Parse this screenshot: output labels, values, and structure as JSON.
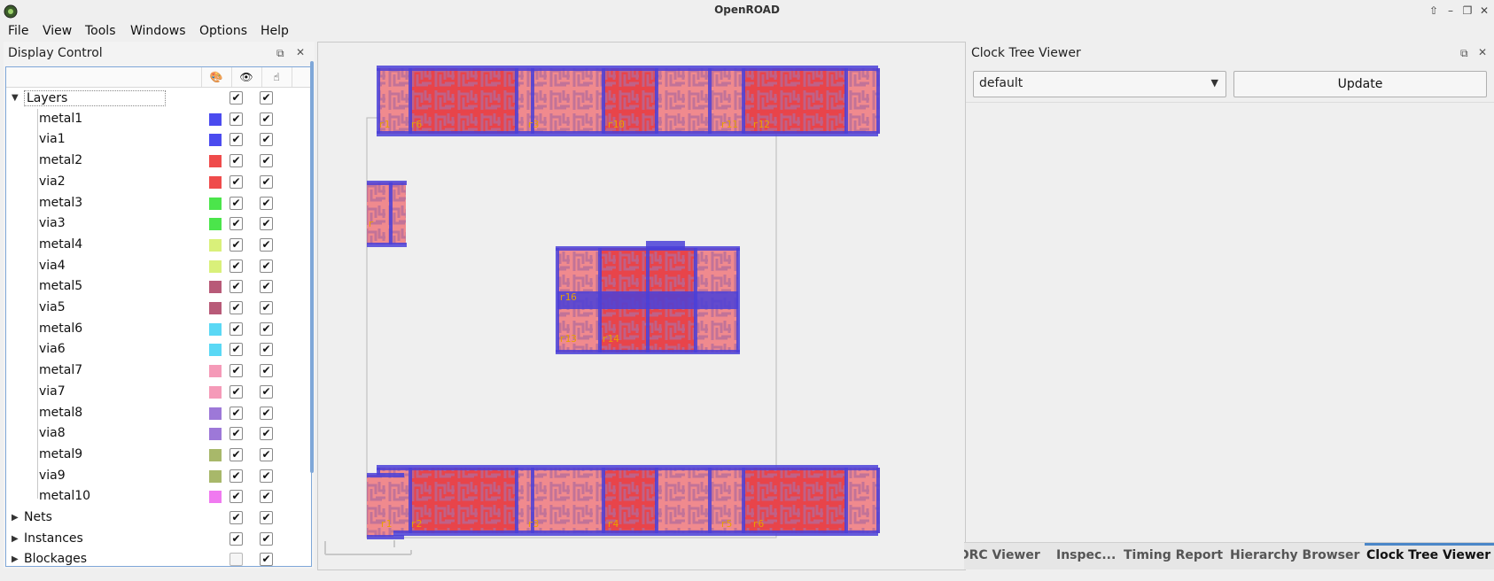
{
  "app": {
    "title": "OpenROAD"
  },
  "menu": [
    "File",
    "View",
    "Tools",
    "Windows",
    "Options",
    "Help"
  ],
  "display_control": {
    "title": "Display Control",
    "layers_label": "Layers",
    "layers": [
      {
        "name": "metal1",
        "color": "#4b4bef"
      },
      {
        "name": "via1",
        "color": "#4b4bef"
      },
      {
        "name": "metal2",
        "color": "#ef4b4b"
      },
      {
        "name": "via2",
        "color": "#ef4b4b"
      },
      {
        "name": "metal3",
        "color": "#4be54b"
      },
      {
        "name": "via3",
        "color": "#4be54b"
      },
      {
        "name": "metal4",
        "color": "#d9f07a"
      },
      {
        "name": "via4",
        "color": "#d9f07a"
      },
      {
        "name": "metal5",
        "color": "#b85a78"
      },
      {
        "name": "via5",
        "color": "#b85a78"
      },
      {
        "name": "metal6",
        "color": "#5ad8f5"
      },
      {
        "name": "via6",
        "color": "#5ad8f5"
      },
      {
        "name": "metal7",
        "color": "#f59ab8"
      },
      {
        "name": "via7",
        "color": "#f59ab8"
      },
      {
        "name": "metal8",
        "color": "#9d78d8"
      },
      {
        "name": "via8",
        "color": "#9d78d8"
      },
      {
        "name": "metal9",
        "color": "#a8b86a"
      },
      {
        "name": "via9",
        "color": "#a8b86a"
      },
      {
        "name": "metal10",
        "color": "#f07af0"
      }
    ],
    "groups": [
      {
        "name": "Nets",
        "visible": true,
        "selectable": true
      },
      {
        "name": "Instances",
        "visible": true,
        "selectable": true
      },
      {
        "name": "Blockages",
        "visible": false,
        "selectable": true
      }
    ]
  },
  "layout": {
    "top_row_labels": [
      "r1",
      "r6",
      "r3",
      "r10",
      "r11",
      "r12"
    ],
    "bottom_row_labels": [
      "r1",
      "r2",
      "r3",
      "r4",
      "r5",
      "r6"
    ],
    "middle_labels": [
      "r16",
      "r13",
      "r14"
    ],
    "left_label": "r"
  },
  "clock_tree": {
    "title": "Clock Tree Viewer",
    "selected": "default",
    "update_label": "Update"
  },
  "tabs": [
    {
      "label": "DRC Viewer",
      "active": false
    },
    {
      "label": "Inspec...",
      "active": false
    },
    {
      "label": "Timing Report",
      "active": false
    },
    {
      "label": "Hierarchy Browser",
      "active": false
    },
    {
      "label": "Clock Tree Viewer",
      "active": true
    }
  ]
}
